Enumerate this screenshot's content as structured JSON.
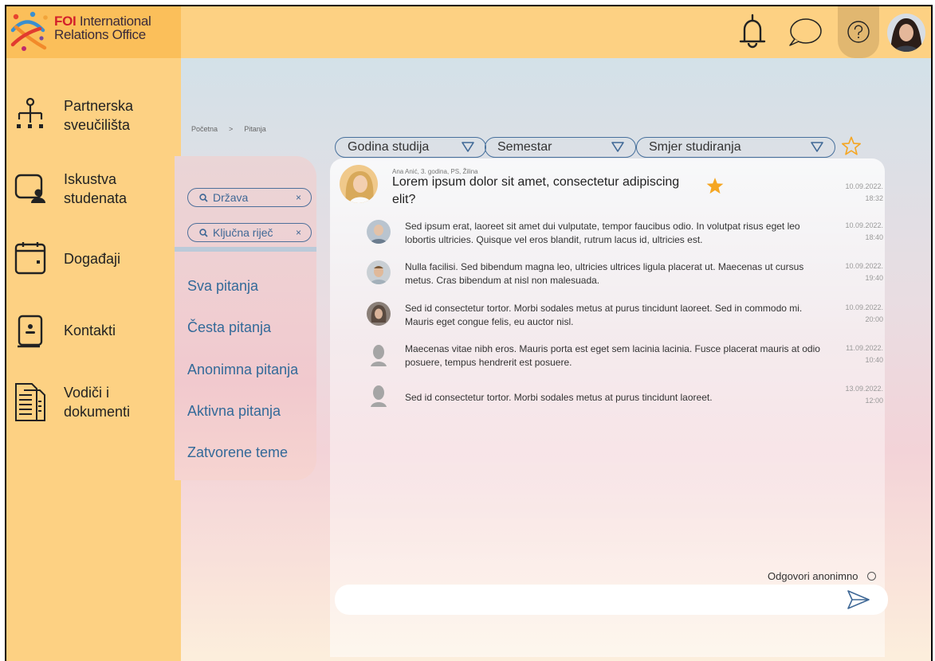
{
  "app": {
    "brand_accent": "FOI",
    "brand_line1_rest": " International",
    "brand_line2": "Relations Office"
  },
  "colors": {
    "topbar": "#fdd183",
    "logo_bg": "#fbbf5a",
    "accent_blue": "#336a99",
    "star": "#f5a623"
  },
  "header": {
    "icons": [
      "bell-icon",
      "chat-bubble-icon",
      "help-icon",
      "avatar"
    ]
  },
  "sidebar": {
    "items": [
      {
        "label": "Partnerska sveučilišta",
        "line1": "Partnerska",
        "line2": "sveučilišta",
        "icon": "network-icon"
      },
      {
        "label": "Iskustva studenata",
        "line1": "Iskustva",
        "line2": "studenata",
        "icon": "student-icon"
      },
      {
        "label": "Događaji",
        "line1": "Događaji",
        "line2": "",
        "icon": "calendar-icon"
      },
      {
        "label": "Kontakti",
        "line1": "Kontakti",
        "line2": "",
        "icon": "contact-book-icon"
      },
      {
        "label": "Vodiči i dokumenti",
        "line1": "Vodiči i",
        "line2": "dokumenti",
        "icon": "documents-icon"
      }
    ]
  },
  "breadcrumb": {
    "home": "Početna",
    "separator": ">",
    "current": "Pitanja"
  },
  "filters": {
    "country_placeholder": "Država",
    "keyword_placeholder": "Ključna riječ",
    "clear": "×",
    "categories": [
      "Sva pitanja",
      "Česta pitanja",
      "Anonimna pitanja",
      "Aktivna pitanja",
      "Zatvorene teme"
    ]
  },
  "dropdowns": {
    "year": "Godina studija",
    "semester": "Semestar",
    "direction": "Smjer studiranja"
  },
  "question": {
    "meta": "Ana Anić, 3. godina, PS, Žilina",
    "text": "Lorem ipsum dolor sit amet, consectetur adipiscing elit?",
    "date": "10.09.2022.",
    "time": "18:32"
  },
  "replies": [
    {
      "text": "Sed ipsum erat, laoreet sit amet dui vulputate, tempor faucibus odio. In volutpat risus eget leo lobortis ultricies. Quisque vel eros blandit, rutrum lacus id, ultricies est.",
      "date": "10.09.2022.",
      "time": "18:40"
    },
    {
      "text": "Nulla facilisi. Sed bibendum magna leo, ultricies ultrices ligula placerat ut. Maecenas ut cursus metus. Cras bibendum at nisl non malesuada.",
      "date": "10.09.2022.",
      "time": "19:40"
    },
    {
      "text": "Sed id consectetur tortor. Morbi sodales metus at purus tincidunt laoreet. Sed in commodo mi. Mauris eget congue felis, eu auctor nisl.",
      "date": "10.09.2022.",
      "time": "20:00"
    },
    {
      "text": "Maecenas vitae nibh eros. Mauris porta est eget sem lacinia lacinia. Fusce placerat mauris at odio posuere, tempus hendrerit est posuere.",
      "date": "11.09.2022.",
      "time": "10:40"
    },
    {
      "text": "Sed id consectetur tortor. Morbi sodales metus at purus tincidunt laoreet.",
      "date": "13.09.2022.",
      "time": "12:00"
    }
  ],
  "compose": {
    "anonymous_label": "Odgovori anonimno",
    "value": ""
  }
}
